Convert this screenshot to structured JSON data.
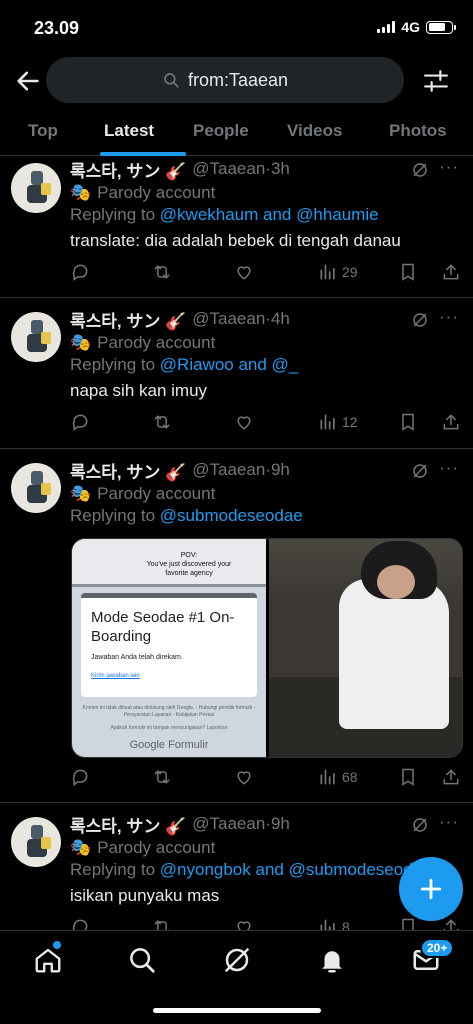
{
  "status_bar": {
    "time": "23.09",
    "network": "4G"
  },
  "search": {
    "query": "from:Taaean"
  },
  "tabs": [
    {
      "label": "Top"
    },
    {
      "label": "Latest"
    },
    {
      "label": "People"
    },
    {
      "label": "Videos"
    },
    {
      "label": "Photos"
    }
  ],
  "active_tab": "Latest",
  "tweets": [
    {
      "name": "록스타, サン 🎸",
      "handle": "@Taaean",
      "time": "3h",
      "parody": "Parody account",
      "reply_prefix": "Replying to ",
      "reply_to": "@kwekhaum and @hhaumie",
      "text": "translate: dia adalah bebek di tengah danau",
      "views": "29"
    },
    {
      "name": "록스타, サン 🎸",
      "handle": "@Taaean",
      "time": "4h",
      "parody": "Parody account",
      "reply_prefix": "Replying to ",
      "reply_to": "@Riawoo and @_",
      "text": "napa sih kan imuy",
      "views": "12"
    },
    {
      "name": "록스타, サン 🎸",
      "handle": "@Taaean",
      "time": "9h",
      "parody": "Parody account",
      "reply_prefix": "Replying to ",
      "reply_to": "@submodeseodae",
      "text": "",
      "views": "68",
      "media": {
        "pov_line1": "POV:",
        "pov_line2": "You've just discovered your favorite agency",
        "form_title": "Mode Seodae #1 On-Boarding",
        "form_sub": "Jawaban Anda telah direkam.",
        "form_link": "Kirim jawaban lain",
        "form_foot1": "Konten ini tidak dibuat atau didukung oleh Google. - Hubungi pemilik formulir - Persyaratan Layanan - Kebijakan Privasi",
        "form_foot2": "Apakah formulir ini tampak mencurigakan? Laporkan",
        "form_logo": "Google Formulir"
      }
    },
    {
      "name": "록스타, サン 🎸",
      "handle": "@Taaean",
      "time": "9h",
      "parody": "Parody account",
      "reply_prefix": "Replying to ",
      "reply_to": "@nyongbok and @submodeseodae",
      "text": "isikan punyaku mas",
      "views": "8"
    }
  ],
  "bottom_nav": {
    "messages_badge": "20+"
  },
  "colors": {
    "accent": "#1d9bf0",
    "background": "#000000",
    "secondary_text": "#71767b"
  },
  "icons": [
    "back-arrow-icon",
    "search-icon",
    "filter-sliders-icon",
    "grok-icon",
    "more-icon",
    "reply-icon",
    "retweet-icon",
    "like-icon",
    "views-icon",
    "bookmark-icon",
    "share-icon",
    "compose-plus-icon",
    "home-icon",
    "explore-icon",
    "bell-icon",
    "mail-icon"
  ]
}
